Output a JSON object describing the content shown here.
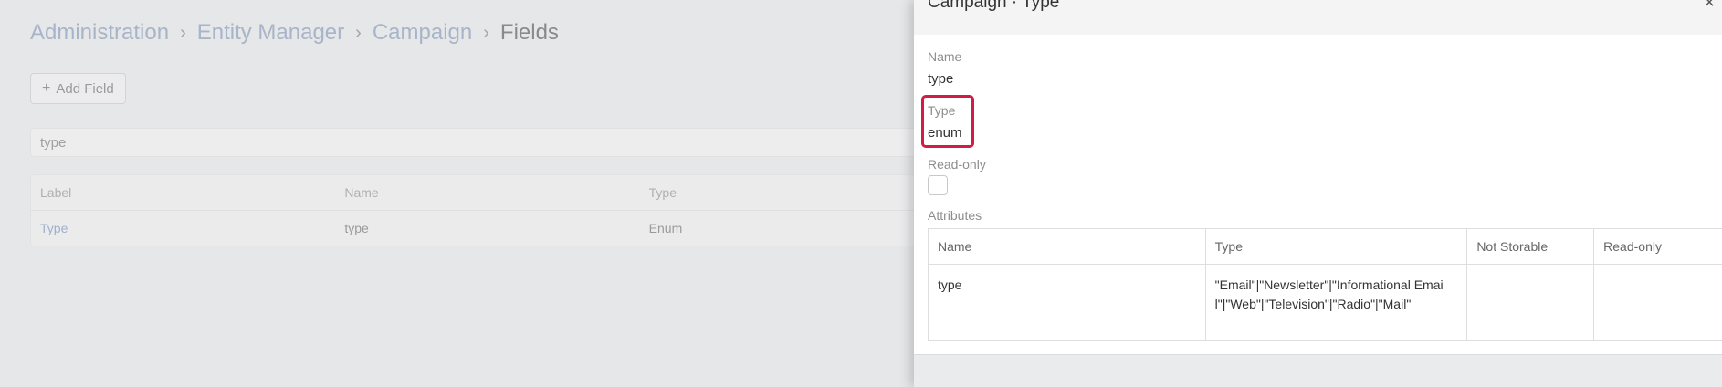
{
  "breadcrumb": {
    "items": [
      "Administration",
      "Entity Manager",
      "Campaign"
    ],
    "separator": "›",
    "current": "Fields"
  },
  "toolbar": {
    "add_field_label": "Add Field"
  },
  "search": {
    "value": "type"
  },
  "fields_table": {
    "columns": [
      "Label",
      "Name",
      "Type"
    ],
    "rows": [
      {
        "label": "Type",
        "name": "type",
        "type": "Enum"
      }
    ]
  },
  "panel": {
    "title": "Campaign · Type",
    "name_label": "Name",
    "name_value": "type",
    "type_label": "Type",
    "type_value": "enum",
    "readonly_label": "Read-only",
    "readonly_checked": false,
    "attributes_label": "Attributes",
    "attributes_table": {
      "columns": [
        "Name",
        "Type",
        "Not Storable",
        "Read-only"
      ],
      "rows": [
        {
          "name": "type",
          "type": "\"Email\"|\"Newsletter\"|\"Informational Email\"|\"Web\"|\"Television\"|\"Radio\"|\"Mail\"",
          "not_storable": "",
          "read_only": ""
        }
      ]
    }
  },
  "colors": {
    "highlight": "#cf1d46",
    "link_dim": "#a8b4c8"
  }
}
